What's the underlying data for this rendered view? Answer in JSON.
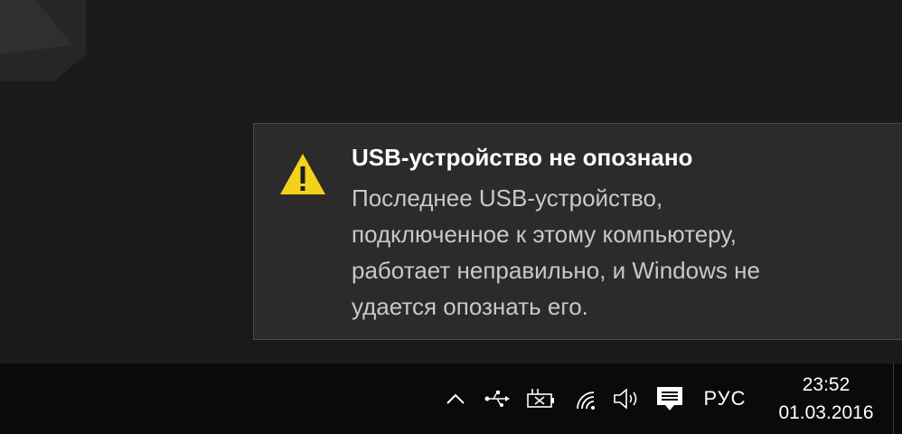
{
  "notification": {
    "icon": "warning-icon",
    "title": "USB-устройство не опознано",
    "body_lines": [
      "Последнее USB-устройство,",
      "подключенное к этому компьютеру,",
      "работает неправильно, и Windows не",
      "удается опознать его."
    ]
  },
  "taskbar": {
    "tray_icons": [
      "chevron-up-icon",
      "usb-icon",
      "battery-icon",
      "wifi-icon",
      "speaker-icon",
      "action-center-icon"
    ],
    "language": "РУС",
    "time": "23:52",
    "date": "01.03.2016"
  },
  "colors": {
    "warning": "#f2d21b",
    "toast_background": "#2b2b2b",
    "taskbar_background": "#0a0a0a"
  }
}
